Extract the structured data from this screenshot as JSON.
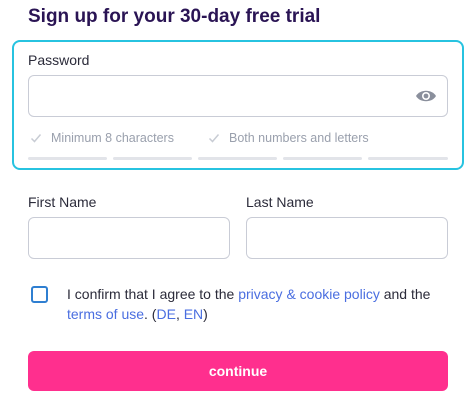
{
  "title": "Sign up for your 30-day free trial",
  "password": {
    "label": "Password",
    "value": "",
    "icon": "eye-icon",
    "requirements": [
      {
        "label": "Minimum 8 characters",
        "met": false
      },
      {
        "label": "Both numbers and letters",
        "met": false
      }
    ],
    "strength_segments": 5,
    "strength_filled": 0,
    "focus_color": "#27c3e0"
  },
  "first_name": {
    "label": "First Name",
    "value": ""
  },
  "last_name": {
    "label": "Last Name",
    "value": ""
  },
  "consent": {
    "checked": false,
    "text_before": "I confirm that I agree to the ",
    "privacy_link": "privacy & cookie policy",
    "text_and": " and the ",
    "terms_link": "terms of use",
    "text_dot_paren": ". (",
    "de_link": "DE",
    "comma": ", ",
    "en_link": "EN",
    "close_paren": ")"
  },
  "continue_label": "continue",
  "colors": {
    "title": "#2a1454",
    "accent_button": "#ff2f8e",
    "link": "#4a6ee0",
    "checkbox_border": "#2f7fd1"
  }
}
